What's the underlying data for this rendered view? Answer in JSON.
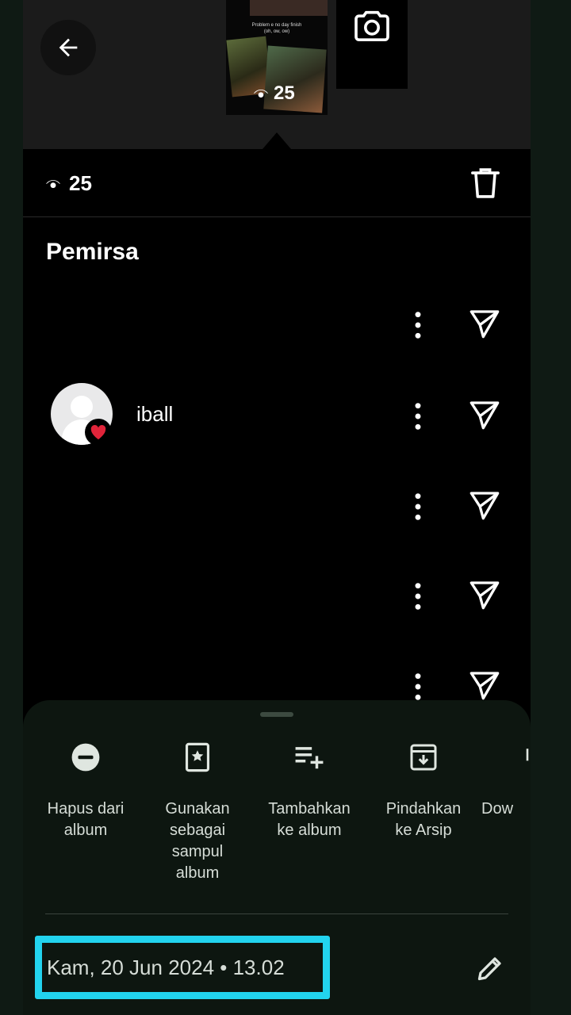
{
  "story": {
    "thumbnail_caption": "Problem e no day finish\n(oh, ow, ow)",
    "thumbnail_views": "25"
  },
  "stats": {
    "views": "25"
  },
  "viewers": {
    "title": "Pemirsa",
    "items": [
      {
        "name": ""
      },
      {
        "name": "iball",
        "reaction": "heart"
      },
      {
        "name": ""
      },
      {
        "name": ""
      },
      {
        "name": ""
      }
    ]
  },
  "actions": [
    {
      "icon": "remove-circle-icon",
      "label": "Hapus dari album"
    },
    {
      "icon": "album-cover-icon",
      "label": "Gunakan sebagai sampul album"
    },
    {
      "icon": "playlist-add-icon",
      "label": "Tambahkan ke album"
    },
    {
      "icon": "archive-icon",
      "label": "Pindahkan ke Arsip"
    },
    {
      "icon": "download-icon",
      "label": "Dow"
    }
  ],
  "footer": {
    "date": "Kam, 20 Jun 2024  •  13.02"
  },
  "colors": {
    "highlight": "#22d3ee",
    "sheet_bg": "#0d1610",
    "heart": "#e0243a"
  }
}
